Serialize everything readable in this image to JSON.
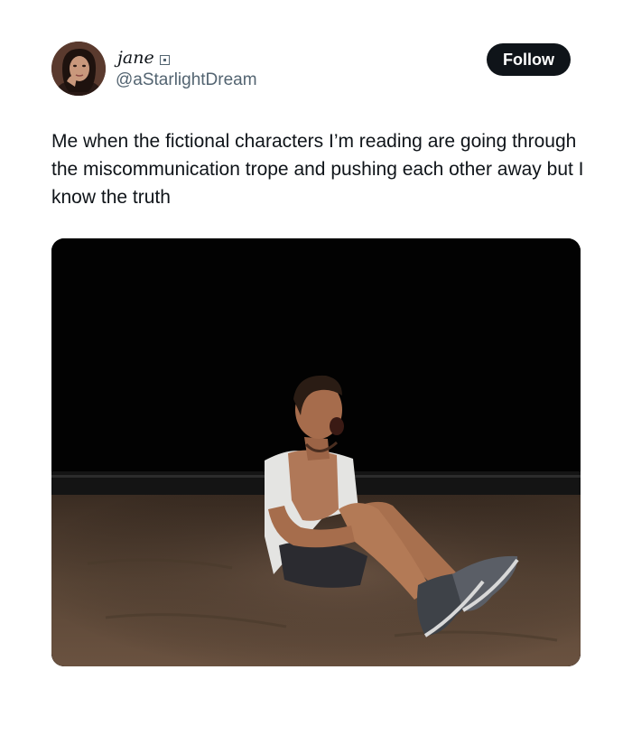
{
  "user": {
    "display_name": "jane",
    "handle": "@aStarlightDream",
    "follow_label": "Follow"
  },
  "tweet": {
    "text": "Me when the fictional characters I’m reading are going through the miscommunication trope and pushing each other away but I know the truth"
  },
  "colors": {
    "text_primary": "#0f1419",
    "text_secondary": "#536471",
    "follow_button_bg": "#0f1419",
    "follow_button_text": "#ffffff",
    "background": "#ffffff"
  },
  "icons": {
    "badge": "square-badge-icon"
  }
}
